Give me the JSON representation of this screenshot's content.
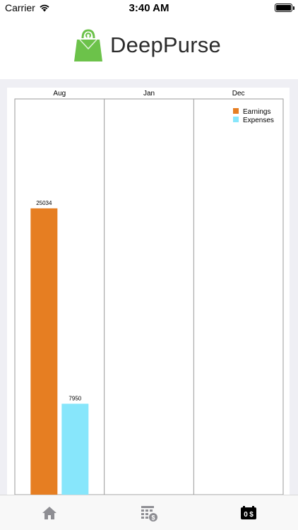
{
  "status_bar": {
    "carrier": "Carrier",
    "time": "3:40 AM",
    "battery_level": 1.0
  },
  "app": {
    "name": "DeepPurse"
  },
  "colors": {
    "earnings": "#E67E22",
    "expenses": "#87E6FB",
    "logo_green": "#6CC24A",
    "tab_active": "#000000",
    "tab_inactive": "#8e8e93"
  },
  "chart_data": {
    "type": "bar",
    "categories": [
      "Aug",
      "Jan",
      "Dec"
    ],
    "series": [
      {
        "name": "Earnings",
        "values": [
          25034,
          null,
          null
        ]
      },
      {
        "name": "Expenses",
        "values": [
          7950,
          null,
          null
        ]
      }
    ],
    "data_labels": [
      "25034",
      "7950"
    ],
    "legend_position": "top-right",
    "grid": true,
    "category_axis_position": "top"
  },
  "tab_bar": {
    "tabs": [
      {
        "name": "Home",
        "icon": "home-icon",
        "active": false
      },
      {
        "name": "Expense Report",
        "icon": "calendar-dollar-icon",
        "active": false
      },
      {
        "name": "Overview",
        "icon": "zero-dollar-icon",
        "active": true
      }
    ]
  }
}
